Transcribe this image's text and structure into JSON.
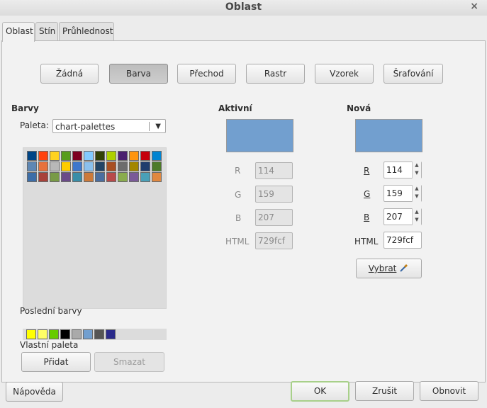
{
  "window": {
    "title": "Oblast",
    "close_glyph": "×"
  },
  "tabs": [
    {
      "label": "Oblast",
      "active": true
    },
    {
      "label": "Stín",
      "active": false
    },
    {
      "label": "Průhlednost",
      "active": false
    }
  ],
  "fill_types": [
    {
      "label": "Žádná",
      "pressed": false
    },
    {
      "label": "Barva",
      "pressed": true
    },
    {
      "label": "Přechod",
      "pressed": false
    },
    {
      "label": "Rastr",
      "pressed": false
    },
    {
      "label": "Vzorek",
      "pressed": false
    },
    {
      "label": "Šrafování",
      "pressed": false
    }
  ],
  "colors": {
    "heading": "Barvy",
    "palette_label": "Paleta:",
    "palette_value": "chart-palettes",
    "swatches_row1": [
      "#004586",
      "#ff420e",
      "#ffd320",
      "#579d1c",
      "#7e0021",
      "#83caff",
      "#314004",
      "#aecf00",
      "#4b1f6f",
      "#ff950e",
      "#c5000b",
      "#0084d1"
    ],
    "swatches_row2": [
      "#5e87b4",
      "#e8723c",
      "#b8b8b8",
      "#ffcc00",
      "#3d77cc",
      "#8bc0ed",
      "#224466",
      "#a84f22",
      "#6c6c6c",
      "#a38600",
      "#1f3d6d",
      "#4d7a28"
    ],
    "swatches_row3": [
      "#3d6ea8",
      "#a8423a",
      "#789a46",
      "#6a4a88",
      "#3a8ea8",
      "#cc7a3a",
      "#4a6ea0",
      "#b84a4a",
      "#8aac4e",
      "#7a5a98",
      "#4aa0b8",
      "#e08840"
    ],
    "recent_label": "Poslední barvy",
    "recent": [
      "#ffff00",
      "#ffff66",
      "#66cc00",
      "#000000",
      "#aaaaaa",
      "#729fcf",
      "#555555",
      "#2a2a8a"
    ],
    "custom_label": "Vlastní paleta",
    "add_button": "Přidat",
    "delete_button": "Smazat"
  },
  "active": {
    "heading": "Aktivní",
    "color": "#729fcf",
    "r_label": "R",
    "r": "114",
    "g_label": "G",
    "g": "159",
    "b_label": "B",
    "b": "207",
    "html_label": "HTML",
    "html": "729fcf"
  },
  "new": {
    "heading": "Nová",
    "color": "#729fcf",
    "r_label": "R",
    "r": "114",
    "g_label": "G",
    "g": "159",
    "b_label": "B",
    "b": "207",
    "html_label": "HTML",
    "html": "729fcf",
    "pick_button": "Vybrat",
    "pick_icon": "pipette-icon"
  },
  "footer": {
    "help": "Nápověda",
    "ok": "OK",
    "cancel": "Zrušit",
    "reset": "Obnovit"
  }
}
